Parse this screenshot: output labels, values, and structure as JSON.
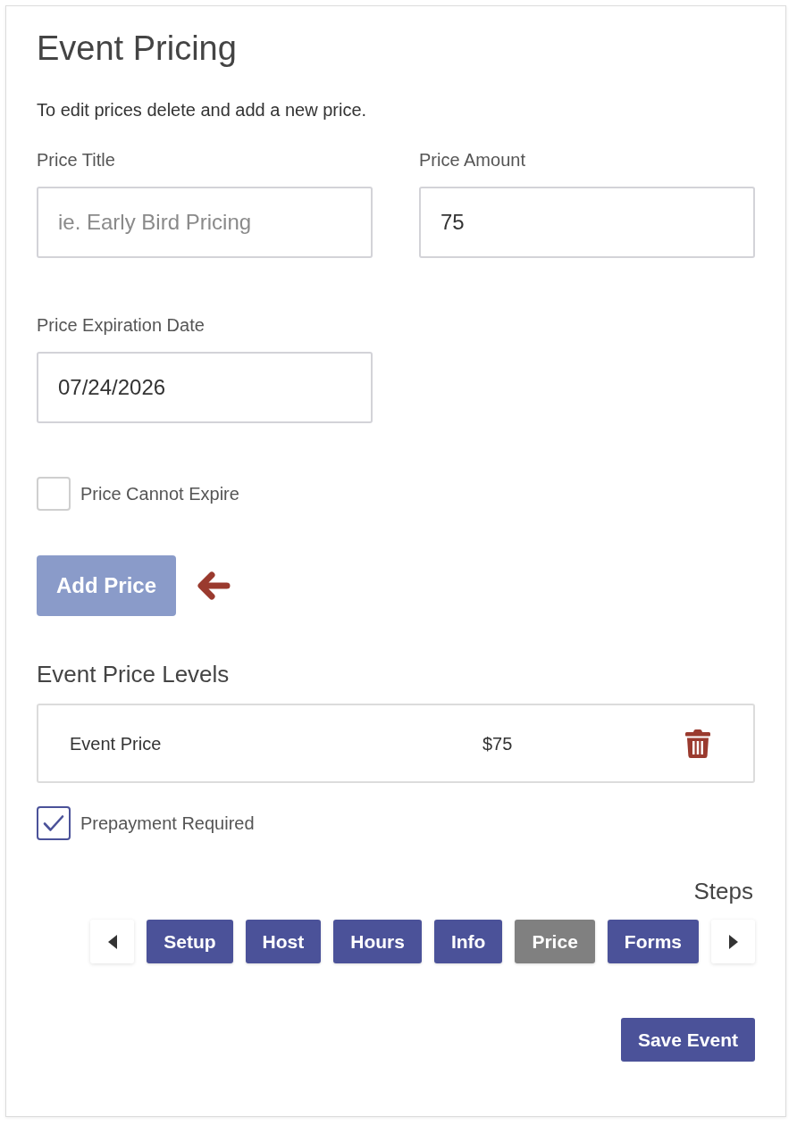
{
  "heading": "Event Pricing",
  "instructions": "To edit prices delete and add a new price.",
  "fields": [
    {
      "label": "Price Title",
      "placeholder": "ie. Early Bird Pricing"
    },
    {
      "label": "Price Amount",
      "value": "75"
    },
    {
      "label": "Price Expiration Date",
      "value": "07/24/2026"
    }
  ],
  "no_expiry_checkbox": {
    "label": "Price Cannot Expire",
    "checked": false
  },
  "add_price_button": {
    "label": "Add Price",
    "disabled": true
  },
  "price_levels": {
    "title": "Event Price Levels",
    "rows": [
      {
        "name": "Event Price",
        "amount": "$75"
      }
    ]
  },
  "prepayment_checkbox": {
    "label": "Prepayment Required",
    "checked": true
  },
  "steps": {
    "title": "Steps",
    "items": [
      {
        "label": "Setup",
        "selected": false
      },
      {
        "label": "Host",
        "selected": false
      },
      {
        "label": "Hours",
        "selected": false
      },
      {
        "label": "Info",
        "selected": false
      },
      {
        "label": "Price",
        "selected": true
      },
      {
        "label": "Forms",
        "selected": false
      }
    ]
  },
  "save_button": {
    "label": "Save Event"
  }
}
